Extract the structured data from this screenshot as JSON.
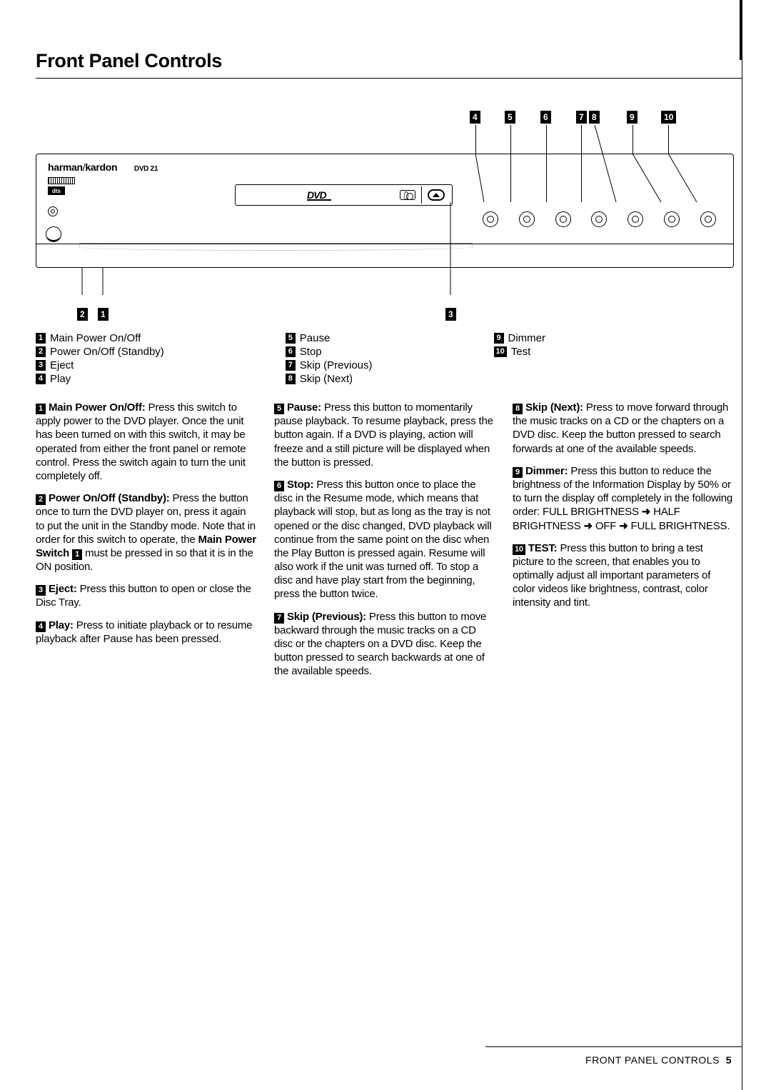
{
  "title": "Front Panel Controls",
  "brand": {
    "a": "harman",
    "b": "kardon",
    "model": "DVD 21"
  },
  "dts": "dts",
  "controls": [
    {
      "n": "1",
      "label": "Main Power On/Off"
    },
    {
      "n": "2",
      "label": "Power On/Off (Standby)"
    },
    {
      "n": "3",
      "label": "Eject"
    },
    {
      "n": "4",
      "label": "Play"
    },
    {
      "n": "5",
      "label": "Pause"
    },
    {
      "n": "6",
      "label": "Stop"
    },
    {
      "n": "7",
      "label": "Skip (Previous)"
    },
    {
      "n": "8",
      "label": "Skip (Next)"
    },
    {
      "n": "9",
      "label": "Dimmer"
    },
    {
      "n": "10",
      "label": "Test"
    }
  ],
  "desc": {
    "d1": {
      "n": "1",
      "h": "Main Power On/Off:",
      "t": " Press this switch to apply power to the DVD player. Once the unit has been turned on with this switch, it may be operated from either the front panel or remote control. Press the switch again to turn the unit completely off."
    },
    "d2a": {
      "n": "2",
      "h": "Power On/Off (Standby):",
      "t": " Press the button once to turn the DVD player on, press it again to put the unit in the Standby mode. Note that in order for this switch to operate, the "
    },
    "d2b": {
      "h": "Main Power Switch",
      "nref": "1",
      "t": " must be pressed in so that it is in the ON position."
    },
    "d3": {
      "n": "3",
      "h": "Eject:",
      "t": " Press this button to open or close the Disc Tray."
    },
    "d4": {
      "n": "4",
      "h": "Play:",
      "t": " Press to initiate playback or to resume playback after Pause has been pressed."
    },
    "d5": {
      "n": "5",
      "h": "Pause:",
      "t": " Press this button to momentarily pause playback. To resume playback, press the button again. If a DVD is playing, action will freeze and a still picture will be displayed when the button is pressed."
    },
    "d6": {
      "n": "6",
      "h": "Stop:",
      "t": " Press this button once to place the disc in the Resume mode, which means that playback will stop, but as long as the tray is not opened or the disc changed, DVD playback will continue from the same point on the disc when the Play Button is pressed again. Resume will also work if the unit was turned off. To stop a disc and have play start from the beginning, press the button twice."
    },
    "d7": {
      "n": "7",
      "h": "Skip (Previous):",
      "t": " Press this button to move backward through the music tracks on a CD disc or the chapters on a DVD disc. Keep the button pressed to search backwards at one of the available speeds."
    },
    "d8": {
      "n": "8",
      "h": "Skip (Next):",
      "t": " Press to move forward through the music tracks on a CD or the chapters on a DVD disc. Keep the button pressed to search forwards at one of the available speeds."
    },
    "d9": {
      "n": "9",
      "h": "Dimmer:",
      "t": " Press this button to reduce the brightness of the Information Display by 50% or to turn the display off completely in the following order: FULL BRIGHTNESS ",
      "seq": [
        "➜",
        " HALF BRIGHTNESS ",
        "➜",
        " OFF ",
        "➜",
        " FULL BRIGHTNESS."
      ]
    },
    "d10": {
      "n": "10",
      "h": "TEST:",
      "t": " Press this button to bring a test picture to the screen, that enables you to optimally adjust all important parameters of color videos like brightness, contrast, color intensity and tint."
    }
  },
  "footer": {
    "label": "FRONT PANEL CONTROLS",
    "page": "5"
  }
}
